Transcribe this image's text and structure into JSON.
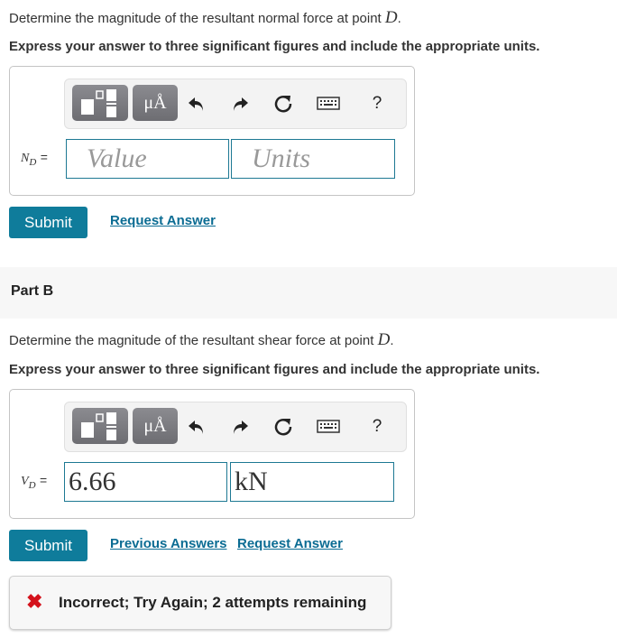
{
  "partA": {
    "prompt": "Determine the magnitude of the resultant normal force at point ",
    "prompt_var": "D",
    "instruction": "Express your answer to three significant figures and include the appropriate units.",
    "toolbar": {
      "templates_icon": "fraction-template-icon",
      "units_label": "μÅ",
      "undo_icon": "undo-icon",
      "redo_icon": "redo-icon",
      "reset_icon": "reset-icon",
      "keyboard_icon": "keyboard-icon",
      "help_label": "?"
    },
    "label_var": "N",
    "label_sub": "D",
    "label_eq": "=",
    "value_placeholder": "Value",
    "units_placeholder": "Units",
    "value": "",
    "units": "",
    "submit_label": "Submit",
    "request_answer_label": "Request Answer"
  },
  "partB": {
    "title": "Part B",
    "prompt": "Determine the magnitude of the resultant shear force at point ",
    "prompt_var": "D",
    "instruction": "Express your answer to three significant figures and include the appropriate units.",
    "toolbar": {
      "units_label": "μÅ",
      "help_label": "?"
    },
    "label_var": "V",
    "label_sub": "D",
    "label_eq": "=",
    "value": "6.66",
    "units": "kN",
    "submit_label": "Submit",
    "previous_answers_label": "Previous Answers",
    "request_answer_label": "Request Answer",
    "feedback": {
      "icon": "x-icon",
      "message": "Incorrect; Try Again; 2 attempts remaining",
      "icon_color": "#d4121c"
    }
  },
  "colors": {
    "accent": "#0f7c9b",
    "link": "#0b6c93",
    "field_border": "#1d7893"
  }
}
